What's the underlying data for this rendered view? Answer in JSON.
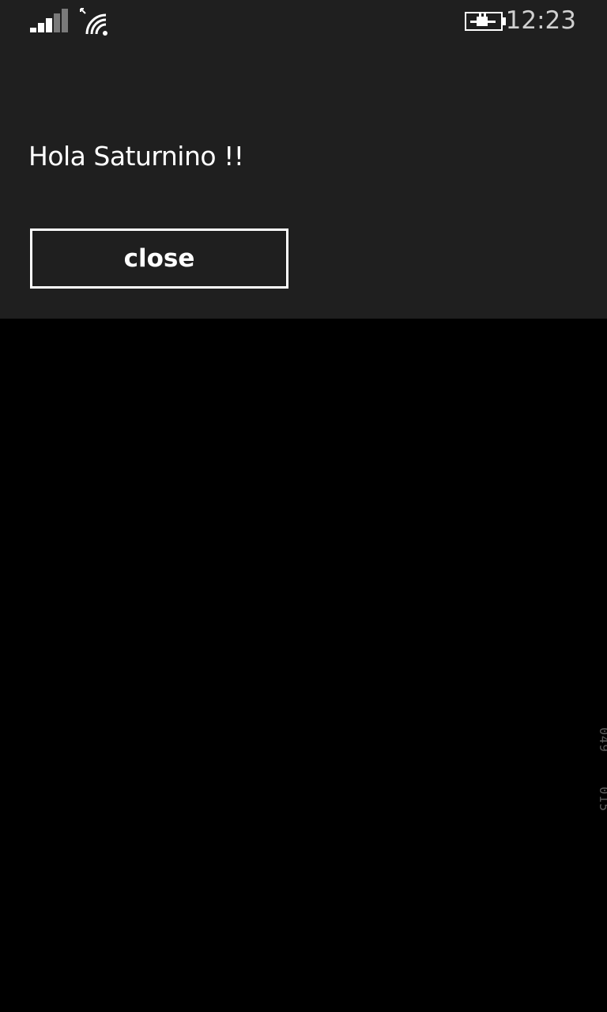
{
  "status_bar": {
    "time": "12:23",
    "signal_icon": "cellular-signal-icon",
    "wifi_icon": "wifi-icon",
    "battery_icon": "battery-charging-icon"
  },
  "dialog": {
    "message": "Hola Saturnino !!",
    "close_label": "close"
  },
  "debug_counter": {
    "first": "049",
    "second": "015"
  },
  "colors": {
    "dialog_background": "#1f1f1f",
    "page_background": "#000000",
    "text": "#ffffff"
  }
}
